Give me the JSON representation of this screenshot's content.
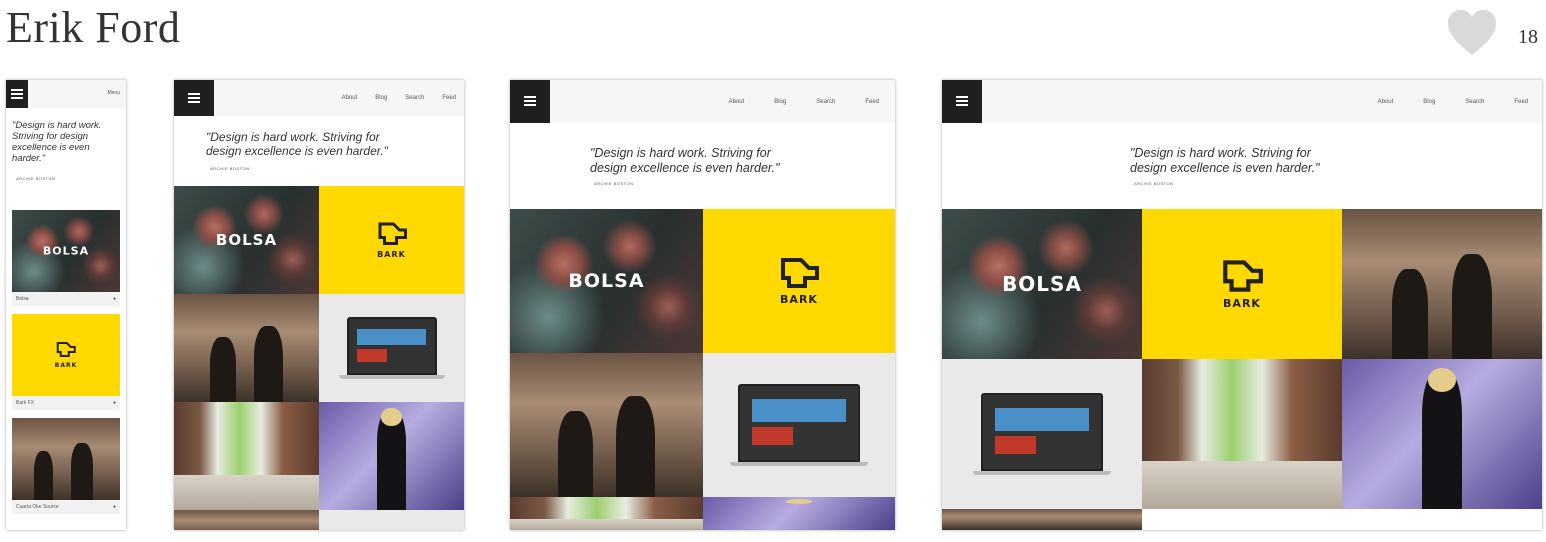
{
  "title": "Erik Ford",
  "likes": {
    "count": "18",
    "icon": "heart-icon",
    "color": "#d9d9d9"
  },
  "mockup": {
    "nav": [
      "About",
      "Blog",
      "Search",
      "Feed"
    ],
    "menu_label": "Menu",
    "quote_narrow": "\"Design is hard work. Striving for design excellence is even harder.\"",
    "quote_line1": "\"Design is hard work. Striving for",
    "quote_line2": "design excellence is even harder.\"",
    "quote_author": "Archie Boston",
    "tiles": {
      "bolsa": "BOLSA",
      "bark": "BARK"
    },
    "captions": [
      "Bolsa",
      "Bark FX",
      "Cuarta Oke Source"
    ]
  },
  "colors": {
    "accent": "#ffd900",
    "logo_bg": "#1f1f1f",
    "header_bg": "#f6f6f6"
  }
}
